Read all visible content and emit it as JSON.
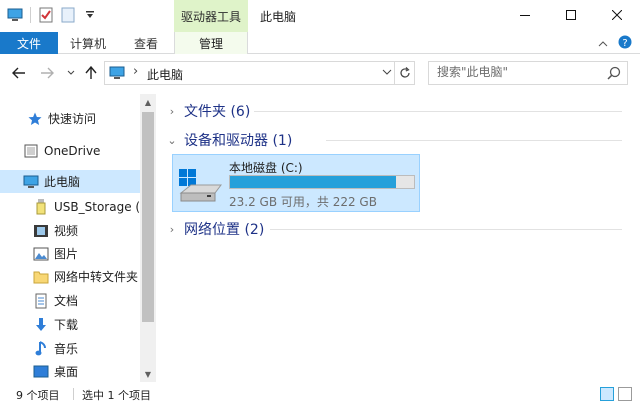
{
  "titlebar": {
    "context_tab": "驱动器工具",
    "title": "此电脑"
  },
  "ribbon": {
    "file_tab": "文件",
    "tabs": [
      "计算机",
      "查看"
    ],
    "manage_tab": "管理"
  },
  "address": {
    "crumb": "此电脑"
  },
  "search": {
    "placeholder": "搜索\"此电脑\""
  },
  "sidebar": {
    "items": [
      {
        "label": "快速访问",
        "icon": "star-icon"
      },
      {
        "label": "OneDrive",
        "icon": "cloud-icon"
      },
      {
        "label": "此电脑",
        "icon": "computer-icon",
        "selected": true
      },
      {
        "label": "USB_Storage (F",
        "icon": "usb-drive-icon"
      },
      {
        "label": "视频",
        "icon": "video-icon"
      },
      {
        "label": "图片",
        "icon": "picture-icon"
      },
      {
        "label": "网络中转文件夹",
        "icon": "folder-icon"
      },
      {
        "label": "文档",
        "icon": "document-icon"
      },
      {
        "label": "下载",
        "icon": "download-icon"
      },
      {
        "label": "音乐",
        "icon": "music-icon"
      },
      {
        "label": "桌面",
        "icon": "desktop-icon"
      }
    ]
  },
  "groups": {
    "folders": "文件夹 (6)",
    "devices": "设备和驱动器 (1)",
    "network": "网络位置 (2)"
  },
  "drive": {
    "name": "本地磁盘 (C:)",
    "free_text": "23.2 GB 可用，共 222 GB",
    "used_fraction": 0.9
  },
  "status": {
    "count": "9 个项目",
    "selected": "选中 1 个项目"
  },
  "colors": {
    "accent": "#1979ca",
    "selection": "#cce8ff",
    "drive_bar": "#26a0da",
    "context_tab": "#dff3c9"
  }
}
